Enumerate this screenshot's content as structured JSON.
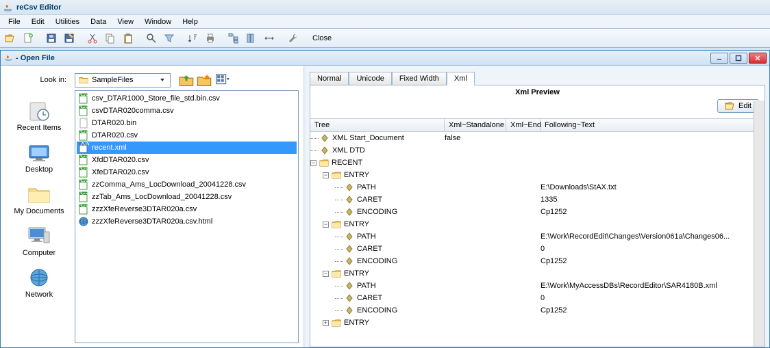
{
  "window": {
    "title": "reCsv Editor"
  },
  "menu": {
    "items": [
      "File",
      "Edit",
      "Utilities",
      "Data",
      "View",
      "Window",
      "Help"
    ]
  },
  "toolbar": {
    "close_label": "Close"
  },
  "openfile": {
    "title": "- Open File",
    "lookin_label": "Look in:",
    "lookin_value": "SampleFiles",
    "places": [
      "Recent Items",
      "Desktop",
      "My Documents",
      "Computer",
      "Network"
    ],
    "files": [
      {
        "name": "csv_DTAR1000_Store_file_std.bin.csv",
        "type": "csv"
      },
      {
        "name": "csvDTAR020comma.csv",
        "type": "csv"
      },
      {
        "name": "DTAR020.bin",
        "type": "bin"
      },
      {
        "name": "DTAR020.csv",
        "type": "csv"
      },
      {
        "name": "recent.xml",
        "type": "xml",
        "selected": true
      },
      {
        "name": "XfdDTAR020.csv",
        "type": "csv"
      },
      {
        "name": "XfeDTAR020.csv",
        "type": "csv"
      },
      {
        "name": "zzComma_Ams_LocDownload_20041228.csv",
        "type": "csv"
      },
      {
        "name": "zzTab_Ams_LocDownload_20041228.csv",
        "type": "csv"
      },
      {
        "name": "zzzXfeReverse3DTAR020a.csv",
        "type": "csv"
      },
      {
        "name": "zzzXfeReverse3DTAR020a.csv.html",
        "type": "html"
      }
    ]
  },
  "preview": {
    "tabs": [
      "Normal",
      "Unicode",
      "Fixed Width",
      "Xml"
    ],
    "active_tab": "Xml",
    "title": "Xml Preview",
    "edit_label": "Edit",
    "columns": [
      "Tree",
      "Xml~Standalone",
      "Xml~End",
      "Following~Text"
    ],
    "tree": [
      {
        "depth": 0,
        "exp": "",
        "icon": "diamond",
        "label": "XML Start_Document",
        "sa": "false",
        "ft": ""
      },
      {
        "depth": 0,
        "exp": "",
        "icon": "diamond",
        "label": "XML DTD",
        "sa": "",
        "ft": ""
      },
      {
        "depth": 0,
        "exp": "-",
        "icon": "folder",
        "label": "RECENT",
        "sa": "",
        "ft": ""
      },
      {
        "depth": 1,
        "exp": "-",
        "icon": "folder",
        "label": "ENTRY",
        "sa": "",
        "ft": ""
      },
      {
        "depth": 2,
        "exp": "",
        "icon": "diamond",
        "label": "PATH",
        "sa": "",
        "ft": "E:\\Downloads\\StAX.txt"
      },
      {
        "depth": 2,
        "exp": "",
        "icon": "diamond",
        "label": "CARET",
        "sa": "",
        "ft": "1335"
      },
      {
        "depth": 2,
        "exp": "",
        "icon": "diamond",
        "label": "ENCODING",
        "sa": "",
        "ft": "Cp1252"
      },
      {
        "depth": 1,
        "exp": "-",
        "icon": "folder",
        "label": "ENTRY",
        "sa": "",
        "ft": ""
      },
      {
        "depth": 2,
        "exp": "",
        "icon": "diamond",
        "label": "PATH",
        "sa": "",
        "ft": "E:\\Work\\RecordEdit\\Changes\\Version061a\\Changes06..."
      },
      {
        "depth": 2,
        "exp": "",
        "icon": "diamond",
        "label": "CARET",
        "sa": "",
        "ft": "0"
      },
      {
        "depth": 2,
        "exp": "",
        "icon": "diamond",
        "label": "ENCODING",
        "sa": "",
        "ft": "Cp1252"
      },
      {
        "depth": 1,
        "exp": "-",
        "icon": "folder",
        "label": "ENTRY",
        "sa": "",
        "ft": ""
      },
      {
        "depth": 2,
        "exp": "",
        "icon": "diamond",
        "label": "PATH",
        "sa": "",
        "ft": "E:\\Work\\MyAccessDBs\\RecordEditor\\SAR4180B.xml"
      },
      {
        "depth": 2,
        "exp": "",
        "icon": "diamond",
        "label": "CARET",
        "sa": "",
        "ft": "0"
      },
      {
        "depth": 2,
        "exp": "",
        "icon": "diamond",
        "label": "ENCODING",
        "sa": "",
        "ft": "Cp1252"
      },
      {
        "depth": 1,
        "exp": "+",
        "icon": "folder",
        "label": "ENTRY",
        "sa": "",
        "ft": ""
      }
    ]
  }
}
